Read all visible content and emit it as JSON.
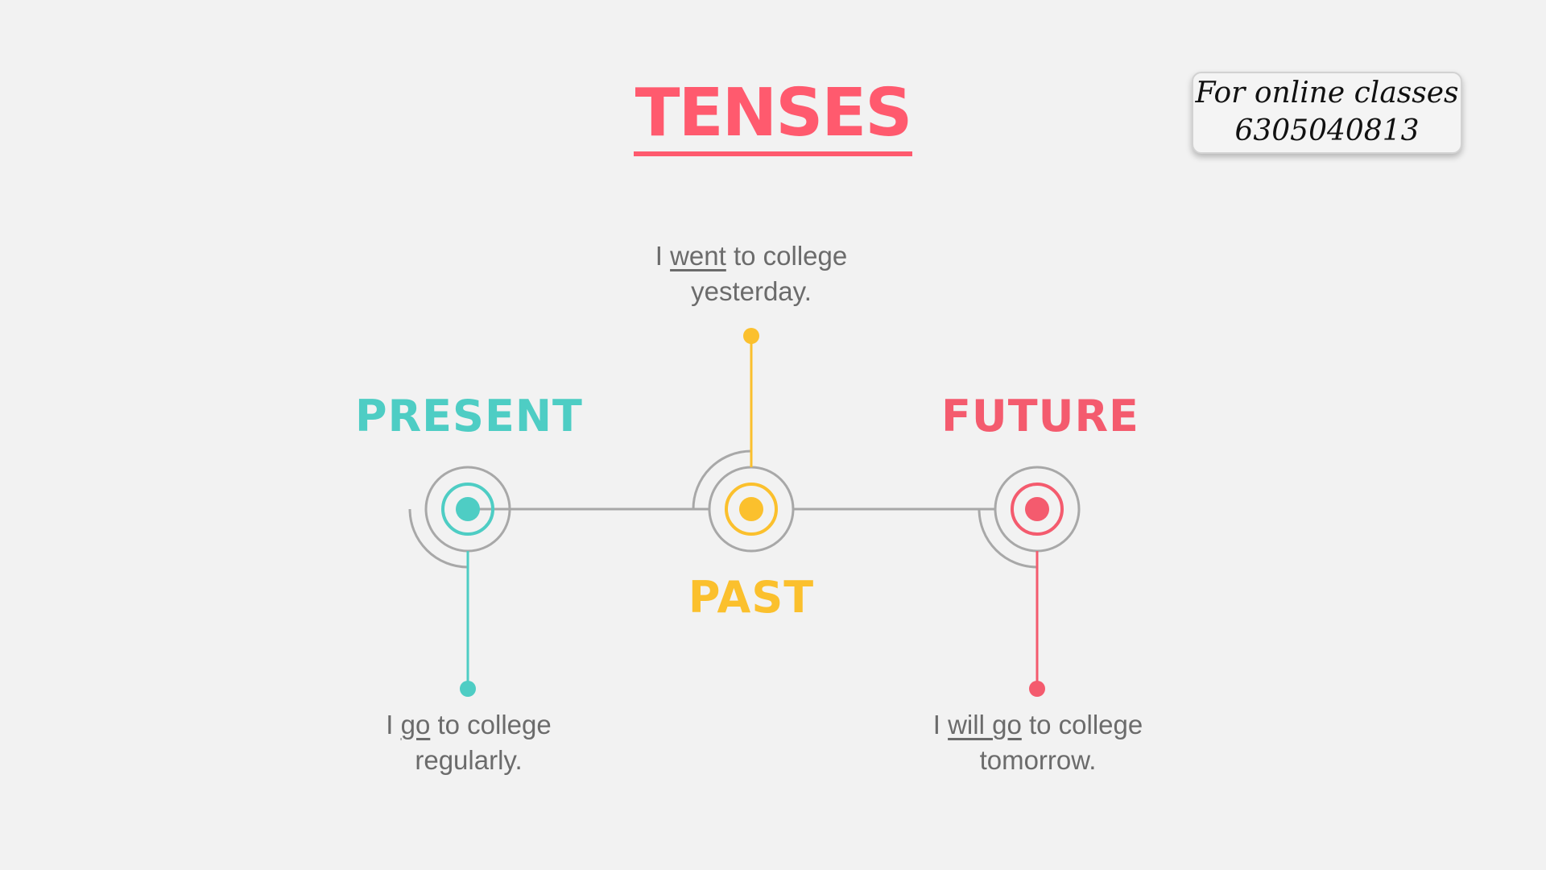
{
  "title": "TENSES",
  "contact": {
    "line1": "For online classes",
    "line2": "6305040813"
  },
  "colors": {
    "present": "#4ecdc4",
    "past": "#fbc02d",
    "future": "#f45b6e",
    "title": "#ff5a6e",
    "line": "#a8a8a8",
    "text": "#6b6b6b"
  },
  "tenses": {
    "present": {
      "label": "PRESENT",
      "sentence": {
        "before": "I ",
        "verb": "go",
        "after": " to college",
        "line2": "regularly."
      }
    },
    "past": {
      "label": "PAST",
      "sentence": {
        "before": "I ",
        "verb": "went",
        "after": " to college",
        "line2": "yesterday."
      }
    },
    "future": {
      "label": "FUTURE",
      "sentence": {
        "before": "I ",
        "verb": "will go",
        "after": " to college",
        "line2": "tomorrow."
      }
    }
  }
}
